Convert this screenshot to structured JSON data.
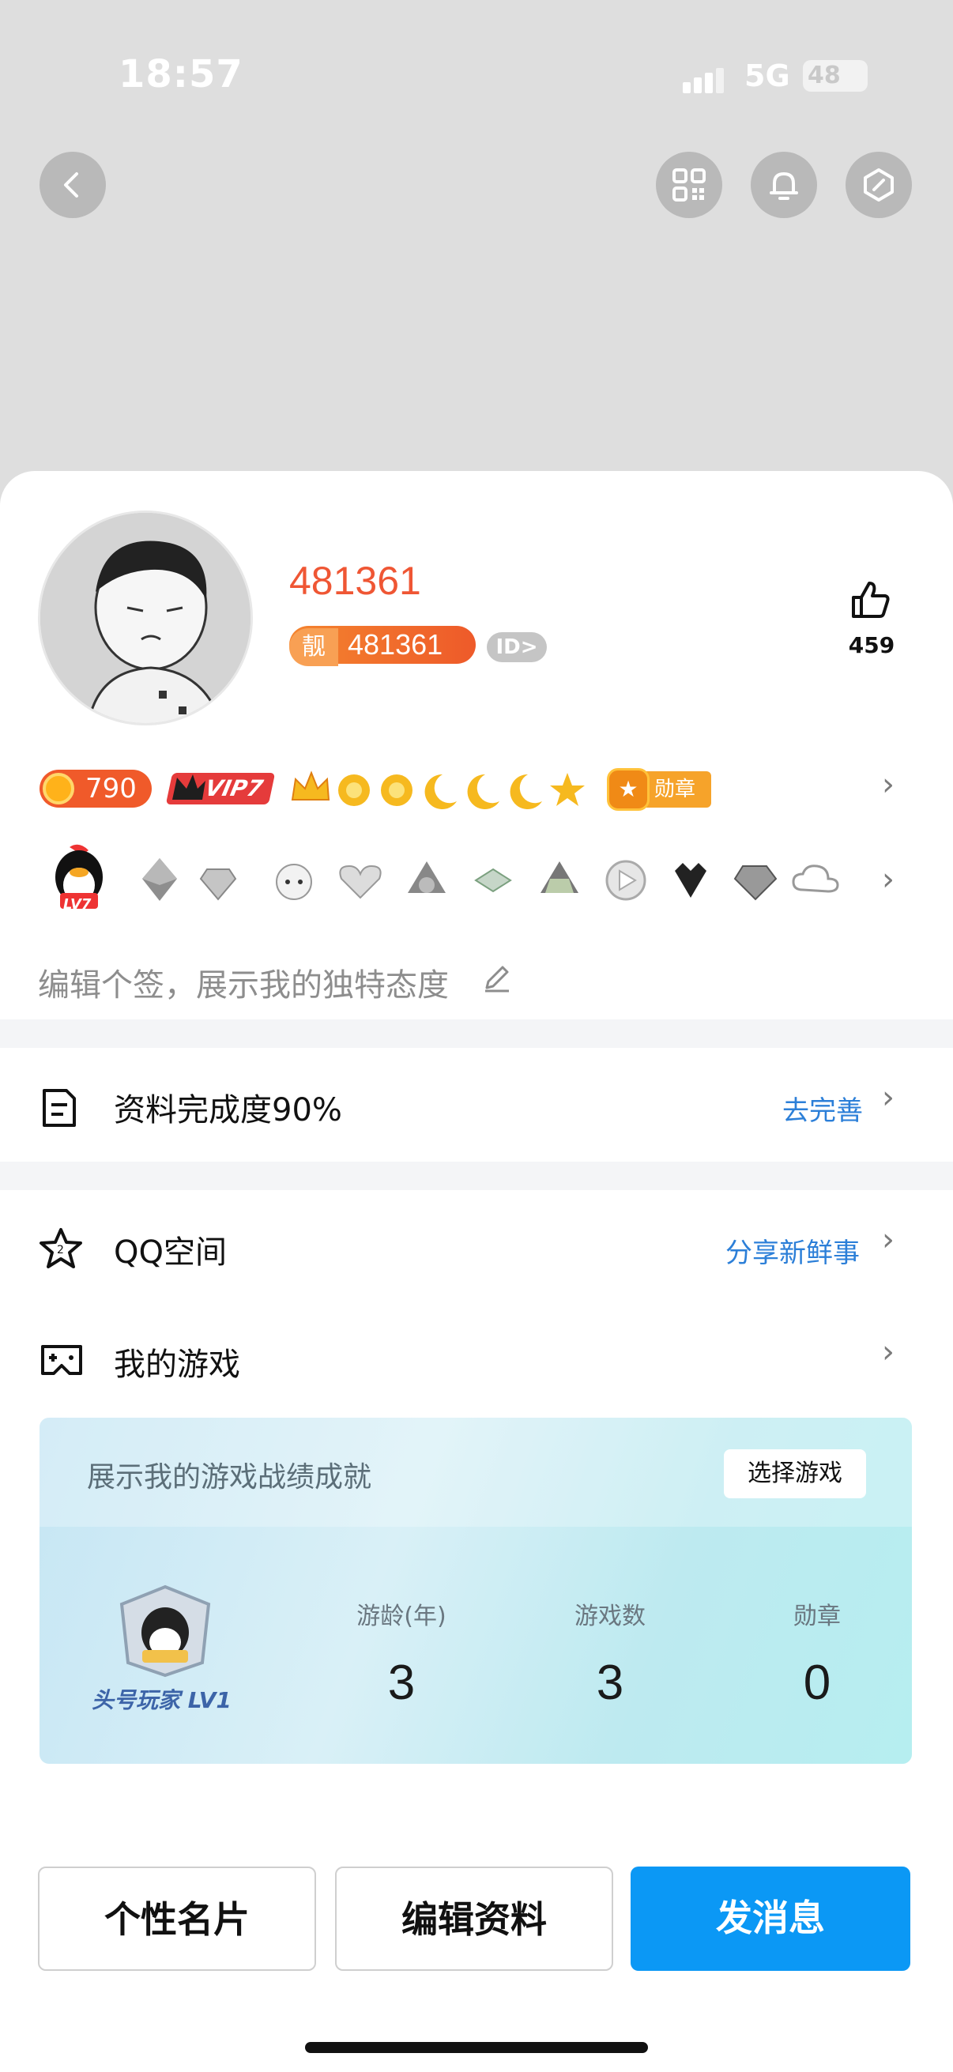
{
  "status": {
    "time": "18:57",
    "network": "5G",
    "battery": "48"
  },
  "profile": {
    "nickname": "481361",
    "qq_tag": "靓",
    "qq_number": "481361",
    "id_label": "ID>",
    "likes": "459"
  },
  "badges": {
    "coins": "790",
    "vip": "VIP7",
    "medal_label": "勋章"
  },
  "achievement_badge": {
    "level": "LV7"
  },
  "signature": {
    "placeholder": "编辑个签，展示我的独特态度"
  },
  "completion": {
    "label": "资料完成度90%",
    "link": "去完善"
  },
  "qzone": {
    "label": "QQ空间",
    "link": "分享新鲜事"
  },
  "games": {
    "label": "我的游戏",
    "card_title": "展示我的游戏战绩成就",
    "select_button": "选择游戏",
    "player_level": "头号玩家 LV1",
    "stats": [
      {
        "label": "游龄(年)",
        "value": "3"
      },
      {
        "label": "游戏数",
        "value": "3"
      },
      {
        "label": "勋章",
        "value": "0"
      }
    ]
  },
  "actions": {
    "card": "个性名片",
    "edit": "编辑资料",
    "message": "发消息"
  },
  "colors": {
    "accent": "#0b98f5",
    "nickname": "#ef5634",
    "link": "#2c7fd8"
  }
}
